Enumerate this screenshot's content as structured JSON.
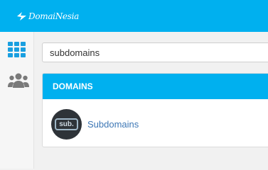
{
  "header": {
    "brand": "DomaiNesia"
  },
  "sidebar": {
    "items": [
      {
        "icon": "apps-grid-icon"
      },
      {
        "icon": "users-icon"
      }
    ]
  },
  "search": {
    "value": "subdomains"
  },
  "domains_panel": {
    "title": "DOMAINS",
    "items": [
      {
        "badge": "sub.",
        "label": "Subdomains"
      }
    ]
  },
  "colors": {
    "brand_blue": "#00b0ef",
    "link_blue": "#3d77b5",
    "icon_blue": "#1a9fe0",
    "icon_gray": "#7a7a7a"
  }
}
